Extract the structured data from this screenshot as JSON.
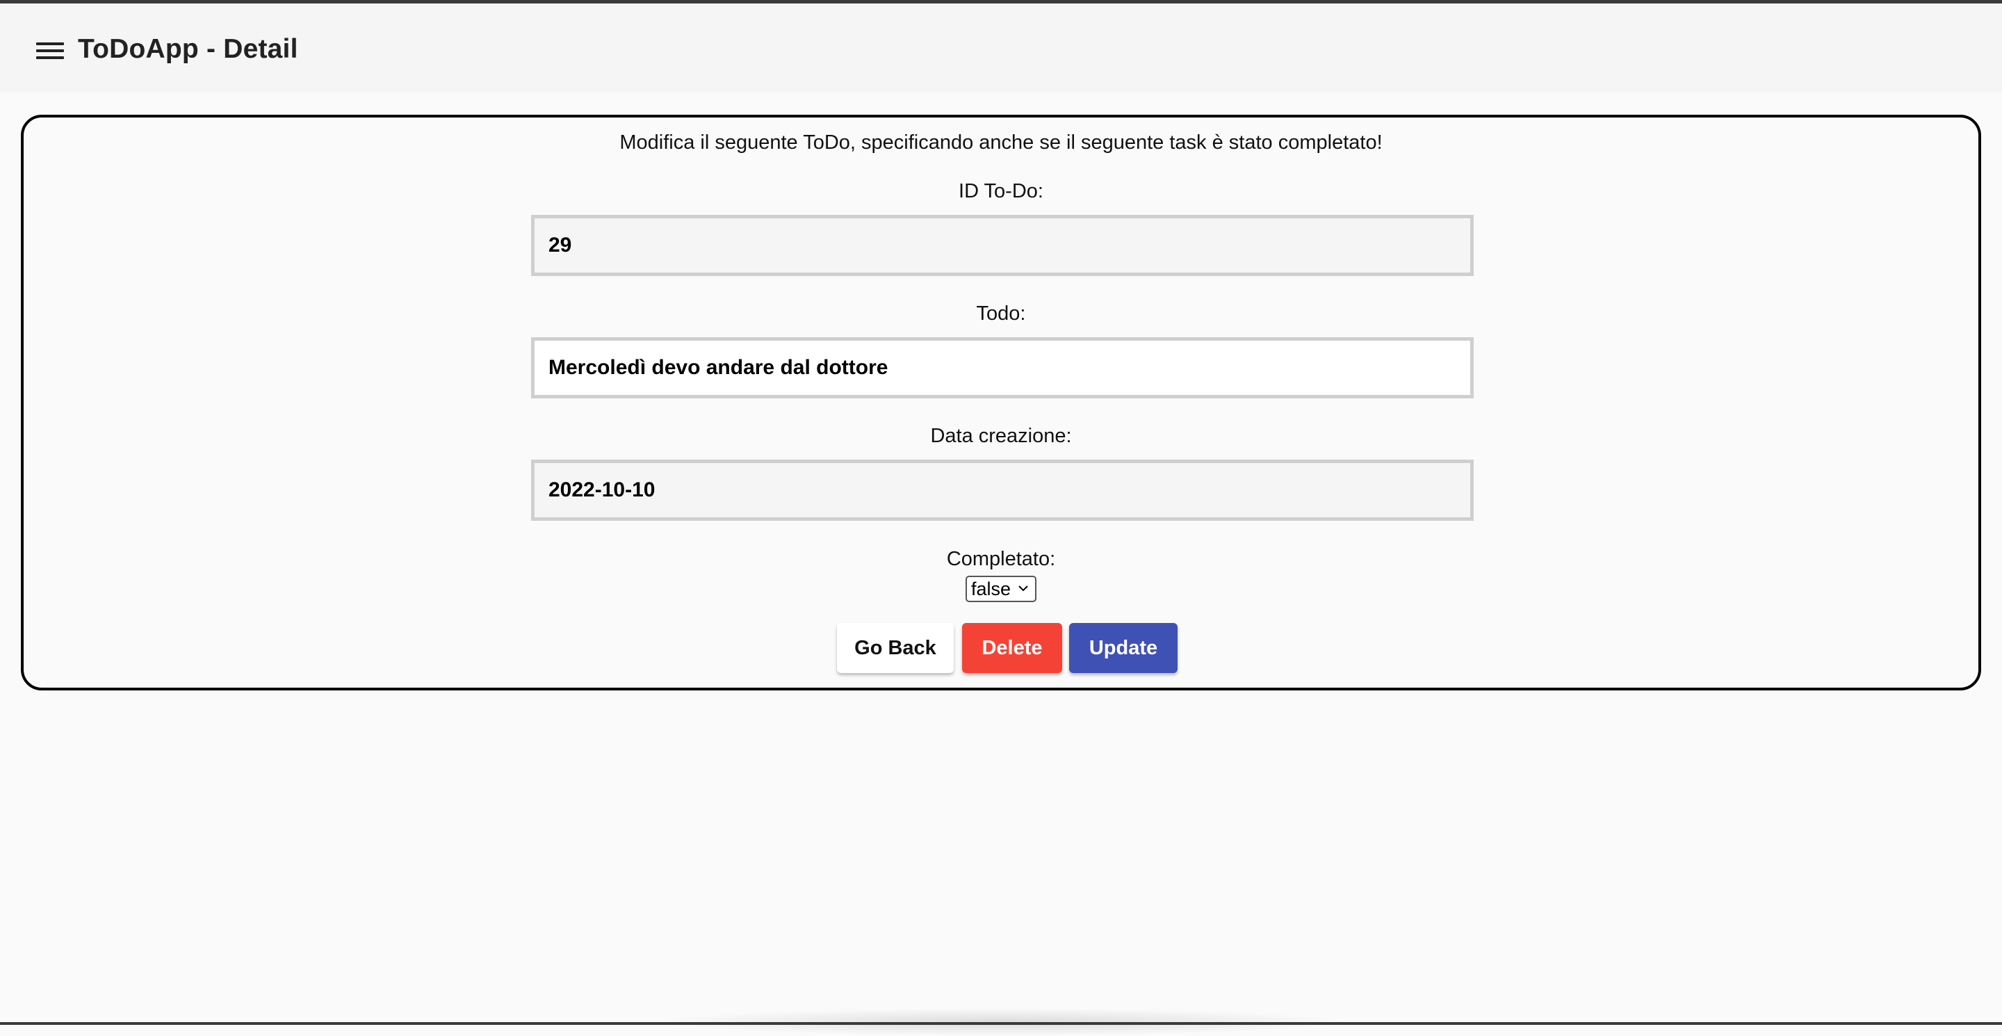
{
  "app": {
    "title": "ToDoApp - Detail"
  },
  "form": {
    "intro": "Modifica il seguente ToDo, specificando anche se il seguente task è stato completato!",
    "id_label": "ID To-Do:",
    "id_value": "29",
    "todo_label": "Todo:",
    "todo_value": "Mercoledì devo andare dal dottore",
    "date_label": "Data creazione:",
    "date_value": "2022-10-10",
    "completed_label": "Completato:",
    "completed_value": "false"
  },
  "actions": {
    "back_label": "Go Back",
    "delete_label": "Delete",
    "update_label": "Update"
  },
  "colors": {
    "delete": "#f44336",
    "update": "#3f51b5",
    "toolbar": "#f5f5f5"
  },
  "icons": {
    "menu": "menu-icon",
    "dropdown": "chevron-down-icon"
  }
}
